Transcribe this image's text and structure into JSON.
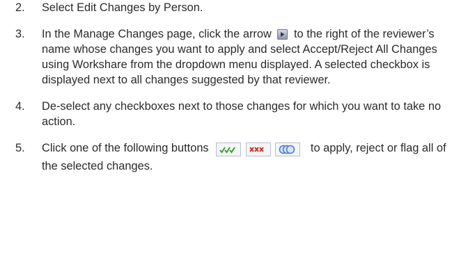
{
  "steps": [
    {
      "number": "2.",
      "text": "Select Edit Changes by Person."
    },
    {
      "number": "3.",
      "text_before": "In the Manage Changes page, click the arrow",
      "text_after": "to the right of the reviewer’s name whose changes you want to apply and select Accept/Reject All Changes using Workshare from the dropdown menu displayed. A selected checkbox is displayed next to all changes suggested by that reviewer.",
      "icon": "arrow-icon"
    },
    {
      "number": "4.",
      "text": "De-select any checkboxes next to those changes for which you want to take no action."
    },
    {
      "number": "5.",
      "text_before": "Click one of the following buttons",
      "text_after": "to apply, reject or flag all of the selected changes.",
      "buttons": [
        "accept-all-icon",
        "reject-all-icon",
        "flag-all-icon"
      ]
    }
  ],
  "colors": {
    "text": "#2b2b2b",
    "accept_check": "#3f9b2c",
    "reject_x": "#c8302b",
    "flag_blue": "#4a7fc8"
  }
}
